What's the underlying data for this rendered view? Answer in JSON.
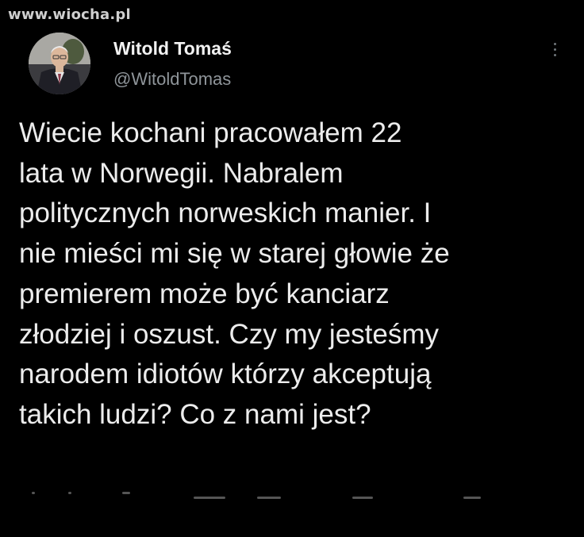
{
  "watermark": {
    "text": "www.wiocha.pl"
  },
  "tweet": {
    "author": {
      "display_name": "Witold Tomaś",
      "handle": "@WitoldTomas",
      "avatar_icon": "profile-photo"
    },
    "more_icon": "vertical-ellipsis-icon",
    "text": "Wiecie kochani pracowałem 22\nlata w Norwegii. Nabralem\npolitycznych norweskich  manier. I\nnie mieści mi się w starej głowie że\npremierem może być kanciarz\nzłodziej i oszust. Czy my jesteśmy\nnarodem idiotów którzy akceptują\ntakich ludzi? Co z nami jest?"
  },
  "colors": {
    "background": "#000000",
    "text_primary": "#ececec",
    "text_secondary": "#8f959a"
  }
}
